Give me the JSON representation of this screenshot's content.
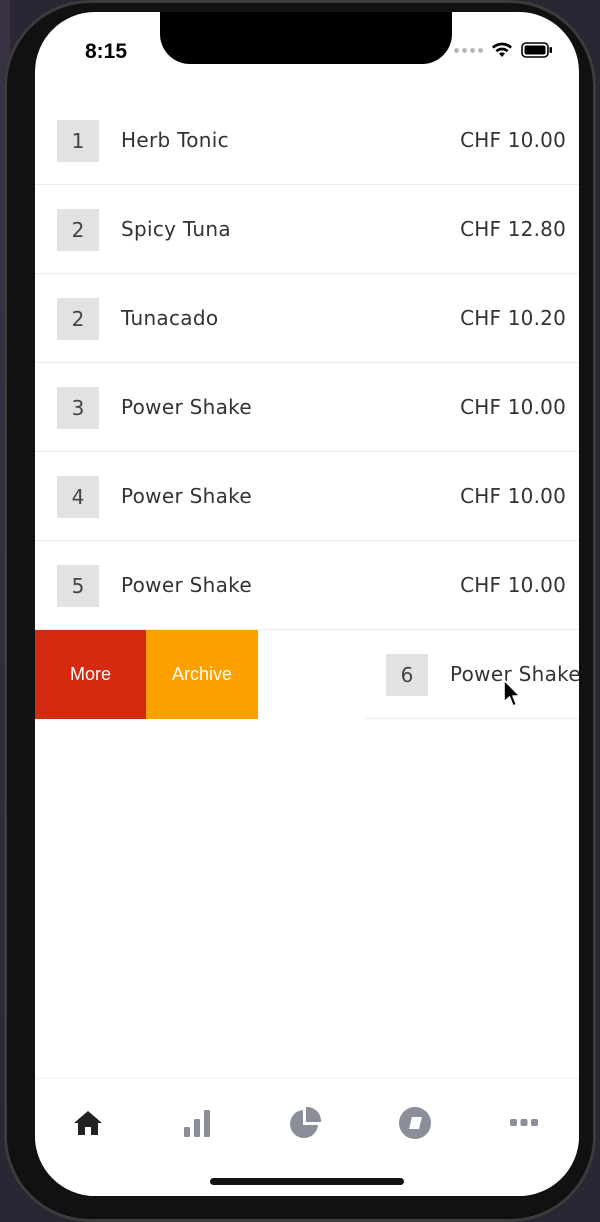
{
  "status_bar": {
    "time": "8:15"
  },
  "orders": [
    {
      "qty": "1",
      "name": "Herb Tonic",
      "price": "CHF 10.00"
    },
    {
      "qty": "2",
      "name": "Spicy Tuna",
      "price": "CHF 12.80"
    },
    {
      "qty": "2",
      "name": "Tunacado",
      "price": "CHF 10.20"
    },
    {
      "qty": "3",
      "name": "Power Shake",
      "price": "CHF 10.00"
    },
    {
      "qty": "4",
      "name": "Power Shake",
      "price": "CHF 10.00"
    },
    {
      "qty": "5",
      "name": "Power Shake",
      "price": "CHF 10.00"
    }
  ],
  "swiped_row": {
    "qty": "6",
    "name": "Power Shake",
    "actions": {
      "more": "More",
      "archive": "Archive"
    },
    "colors": {
      "more": "#d62a10",
      "archive": "#fca000"
    }
  },
  "tab_bar": {
    "items": [
      {
        "icon": "home-icon",
        "active": true
      },
      {
        "icon": "bar-chart-icon",
        "active": false
      },
      {
        "icon": "pie-chart-icon",
        "active": false
      },
      {
        "icon": "compass-icon",
        "active": false
      },
      {
        "icon": "more-dots-icon",
        "active": false
      }
    ],
    "active_color": "#222222",
    "inactive_color": "#8a8e99"
  }
}
